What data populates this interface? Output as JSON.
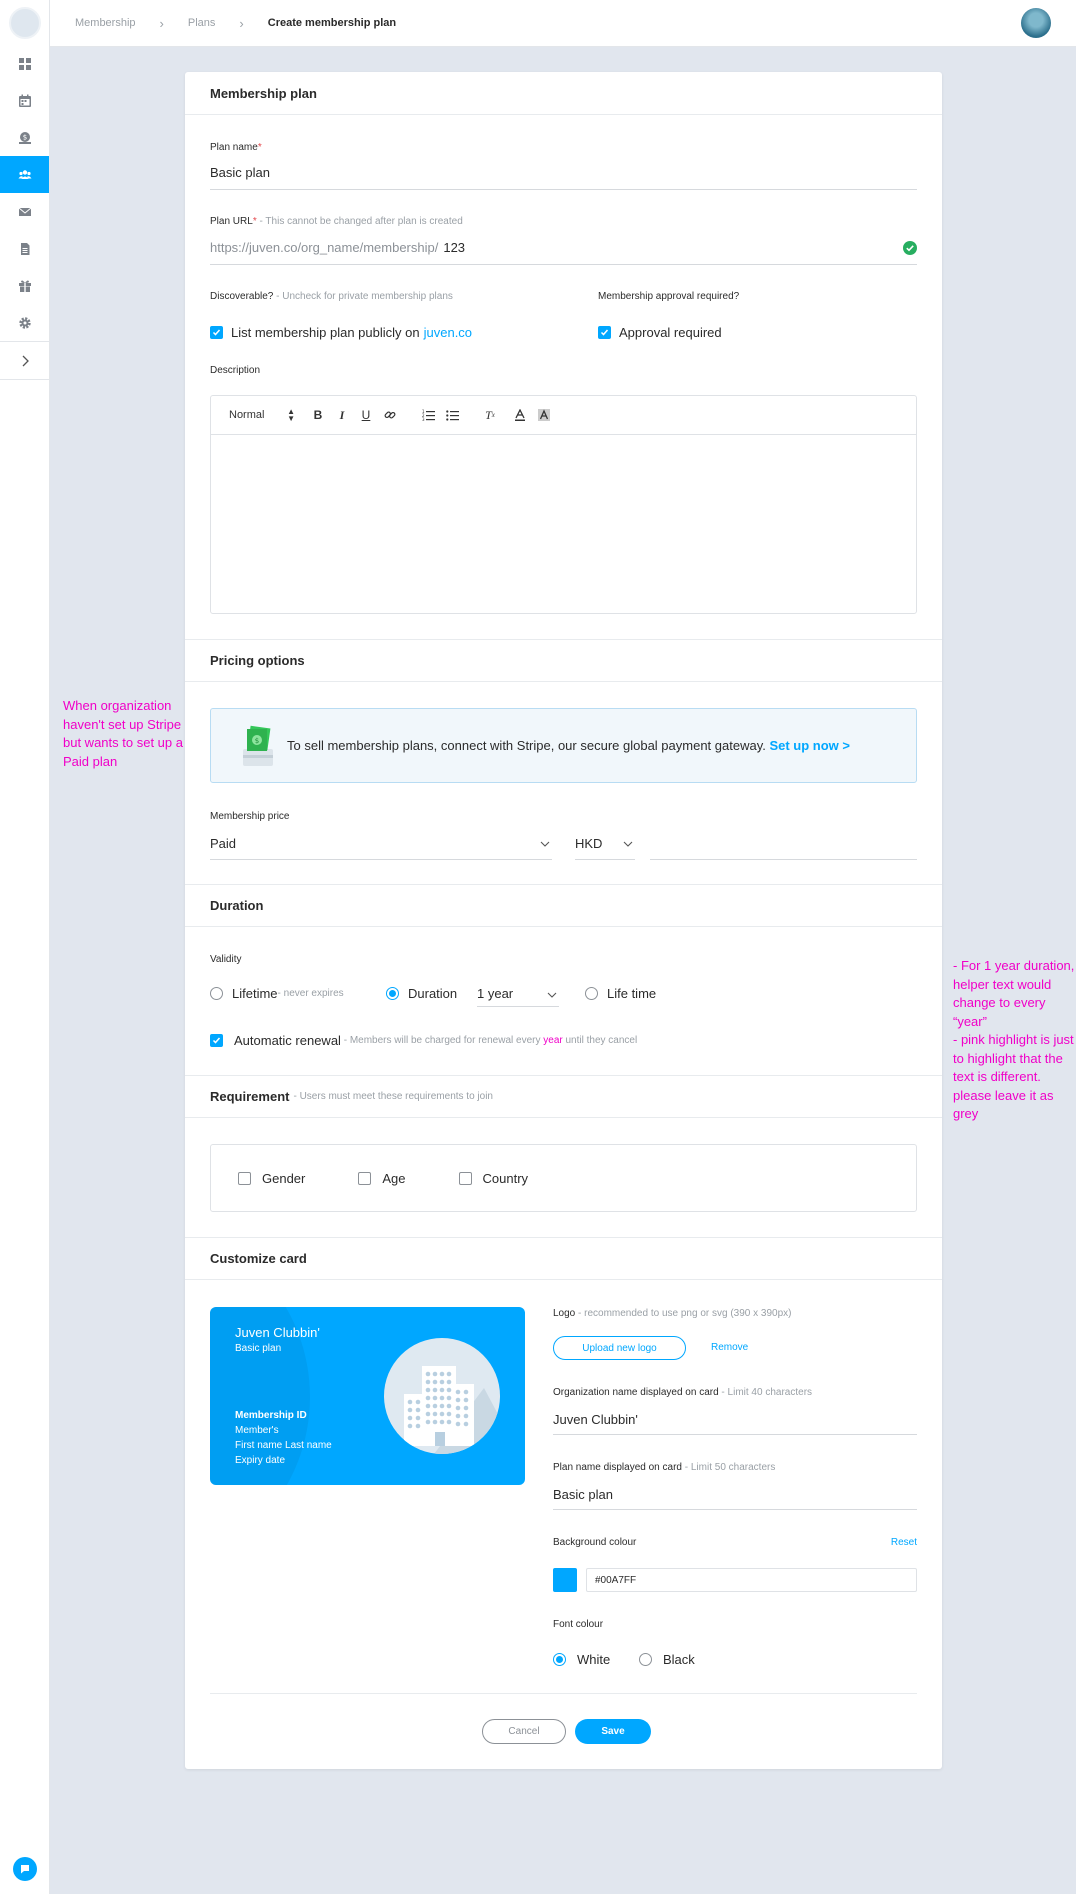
{
  "breadcrumb": [
    "Membership",
    "Plans",
    "Create membership plan"
  ],
  "sidebar": {
    "items": [
      {
        "icon": "dashboard-icon",
        "active": false
      },
      {
        "icon": "calendar-icon",
        "active": false
      },
      {
        "icon": "money-icon",
        "active": false
      },
      {
        "icon": "members-icon",
        "active": true
      },
      {
        "icon": "mail-icon",
        "active": false
      },
      {
        "icon": "document-icon",
        "active": false
      },
      {
        "icon": "gift-icon",
        "active": false
      },
      {
        "icon": "gear-icon",
        "active": false
      }
    ],
    "expand_icon": "chevron-right-icon",
    "chat_icon": "chat-icon"
  },
  "plan": {
    "section_title": "Membership plan",
    "name_label": "Plan name",
    "name_required": "*",
    "name_value": "Basic plan",
    "url_label": "Plan URL",
    "url_required": "*",
    "url_helper": " - This cannot be changed after plan is created",
    "url_prefix": "https://juven.co/org_name/membership/",
    "url_value": "123",
    "discoverable_label": "Discoverable?",
    "discoverable_helper": " - Uncheck for private membership plans",
    "discoverable_text": "List membership plan publicly on ",
    "discoverable_link": "juven.co",
    "approval_label": "Membership approval required?",
    "approval_text": "Approval required",
    "description_label": "Description",
    "editor_format": "Normal"
  },
  "pricing": {
    "section_title": "Pricing options",
    "stripe_text": "To sell membership plans, connect with Stripe, our secure global payment gateway. ",
    "stripe_link": "Set up now >",
    "price_label": "Membership price",
    "price_type": "Paid",
    "currency": "HKD",
    "amount": ""
  },
  "duration": {
    "section_title": "Duration",
    "validity_label": "Validity",
    "lifetime_label": "Lifetime",
    "lifetime_helper": " - never expires",
    "duration_label": "Duration",
    "duration_value": "1 year",
    "life_time_label": "Life time",
    "renewal_label": "Automatic renewal",
    "renewal_helper_a": " - Members will be charged for renewal every ",
    "renewal_helper_highlight": "year",
    "renewal_helper_b": " until they cancel"
  },
  "requirement": {
    "section_title": "Requirement",
    "helper": " - Users must meet these requirements to join",
    "options": [
      "Gender",
      "Age",
      "Country"
    ]
  },
  "customize": {
    "section_title": "Customize card",
    "card_org": "Juven Clubbin'",
    "card_plan": "Basic plan",
    "card_id_label": "Membership ID",
    "card_line2": "Member's",
    "card_line3": "First name Last name",
    "card_line4": "Expiry date",
    "logo_label": "Logo",
    "logo_helper": " - recommended to use png or svg (390 x 390px)",
    "upload_button": "Upload new logo",
    "remove_link": "Remove",
    "org_name_label": "Organization name displayed on card",
    "org_name_helper": " - Limit 40 characters",
    "org_name_value": "Juven Clubbin'",
    "plan_name_label": "Plan name displayed on card",
    "plan_name_helper": " - Limit 50 characters",
    "plan_name_value": "Basic plan",
    "bg_label": "Background colour",
    "reset_link": "Reset",
    "bg_value": "#00A7FF",
    "bg_color": "#00a7ff",
    "font_label": "Font colour",
    "font_white": "White",
    "font_black": "Black"
  },
  "actions": {
    "cancel": "Cancel",
    "save": "Save"
  },
  "notes": {
    "left": "When organization haven't set up Stripe but wants to set up a Paid plan",
    "right": "- For 1 year duration, helper text would change to every “year”\n- pink highlight is just to highlight that the text is different. please leave it as grey",
    "color": "#f000c8"
  }
}
